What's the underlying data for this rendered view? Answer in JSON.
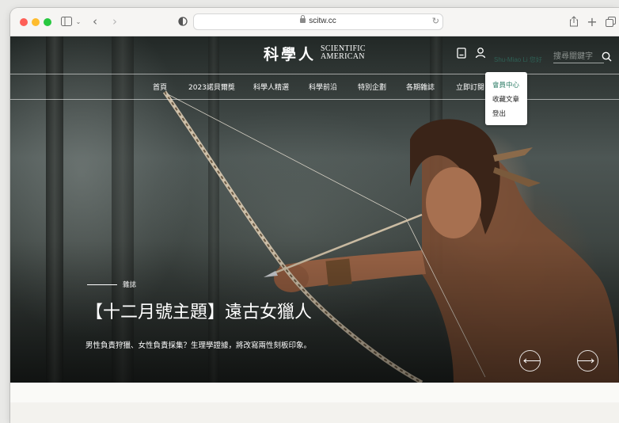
{
  "browser": {
    "url": "scitw.cc",
    "icons": [
      "sidebar-icon",
      "chevron-down-icon",
      "back-icon",
      "forward-icon",
      "privacy-icon",
      "lock-icon",
      "reload-icon",
      "share-icon",
      "new-tab-icon",
      "tabs-icon"
    ]
  },
  "site": {
    "brand_cn": "科學人",
    "brand_en_line1": "SCIENTIFIC",
    "brand_en_line2": "AMERICAN",
    "user_name": "Shu-Miao Li 您好",
    "search_placeholder": "搜尋關鍵字",
    "nav": [
      "首頁",
      "2023諾貝爾獎",
      "科學人精選",
      "科學前沿",
      "特別企劃",
      "各期雜誌",
      "立即訂閱"
    ],
    "dropdown": [
      "會員中心",
      "收藏文章",
      "登出"
    ]
  },
  "hero": {
    "category": "雜誌",
    "title": "【十二月號主題】遠古女獵人",
    "subtitle": "男性負責狩獵、女性負責採集？生理學證據，將改寫兩性刻板印象。"
  },
  "colors": {
    "accent": "#2e7d67",
    "traffic_red": "#fe5f57",
    "traffic_yellow": "#febc2e",
    "traffic_green": "#28c840"
  }
}
